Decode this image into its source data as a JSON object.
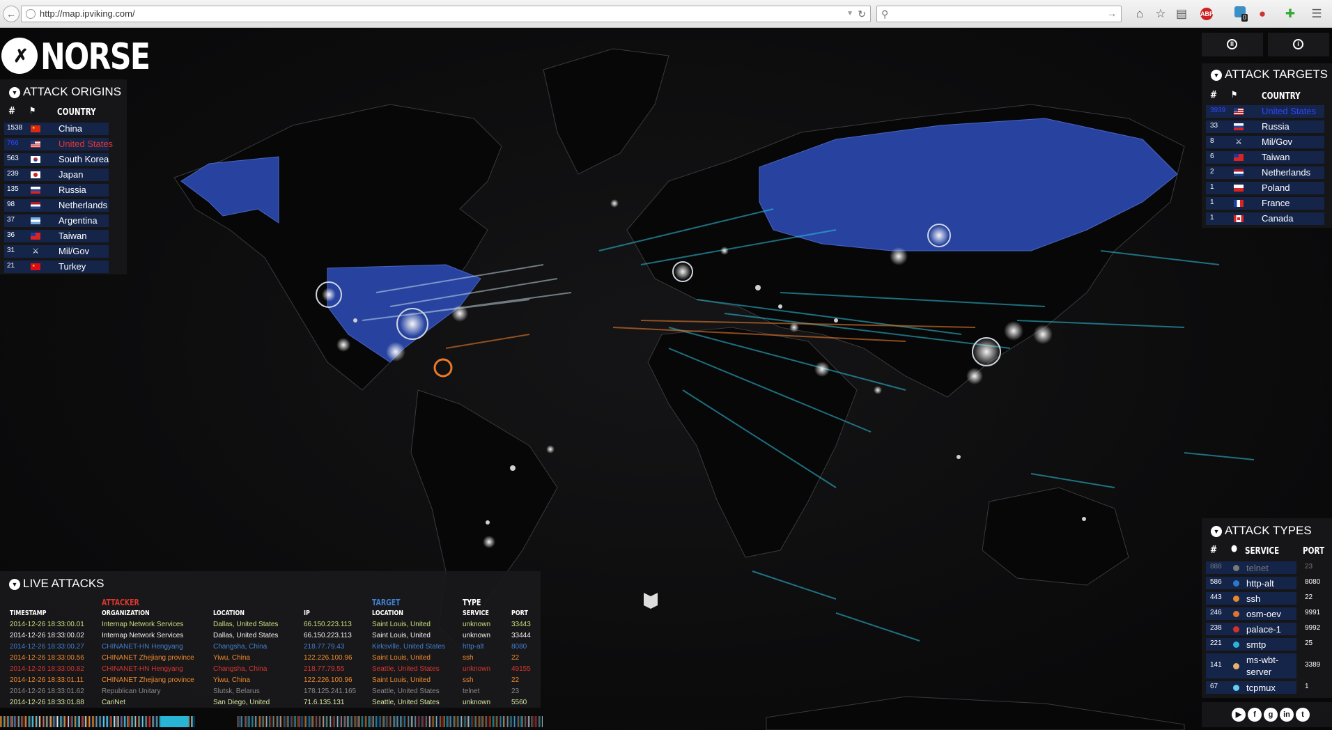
{
  "browser": {
    "url": "http://map.ipviking.com/",
    "badge_count": "0",
    "abp_label": "ABP"
  },
  "logo": {
    "wordmark": "NORSE"
  },
  "origins": {
    "title": "ATTACK ORIGINS",
    "col_country": "COUNTRY",
    "rows": [
      {
        "count": "1538",
        "country": "China",
        "highlight": false
      },
      {
        "count": "766",
        "country": "United States",
        "highlight": true
      },
      {
        "count": "563",
        "country": "South Korea",
        "highlight": false
      },
      {
        "count": "239",
        "country": "Japan",
        "highlight": false
      },
      {
        "count": "135",
        "country": "Russia",
        "highlight": false
      },
      {
        "count": "98",
        "country": "Netherlands",
        "highlight": false
      },
      {
        "count": "37",
        "country": "Argentina",
        "highlight": false
      },
      {
        "count": "36",
        "country": "Taiwan",
        "highlight": false
      },
      {
        "count": "31",
        "country": "Mil/Gov",
        "highlight": false
      },
      {
        "count": "21",
        "country": "Turkey",
        "highlight": false
      }
    ]
  },
  "targets": {
    "title": "ATTACK TARGETS",
    "col_country": "COUNTRY",
    "rows": [
      {
        "count": "3939",
        "country": "United States",
        "highlight": true
      },
      {
        "count": "33",
        "country": "Russia",
        "highlight": false
      },
      {
        "count": "8",
        "country": "Mil/Gov",
        "highlight": false
      },
      {
        "count": "6",
        "country": "Taiwan",
        "highlight": false
      },
      {
        "count": "2",
        "country": "Netherlands",
        "highlight": false
      },
      {
        "count": "1",
        "country": "Poland",
        "highlight": false
      },
      {
        "count": "1",
        "country": "France",
        "highlight": false
      },
      {
        "count": "1",
        "country": "Canada",
        "highlight": false
      }
    ]
  },
  "types": {
    "title": "ATTACK TYPES",
    "col_service": "SERVICE",
    "col_port": "PORT",
    "rows": [
      {
        "count": "888",
        "service": "telnet",
        "port": "23",
        "color": "#7a7a7a",
        "dim": true
      },
      {
        "count": "586",
        "service": "http-alt",
        "port": "8080",
        "color": "#2c78c8",
        "dim": false
      },
      {
        "count": "443",
        "service": "ssh",
        "port": "22",
        "color": "#e58a2a",
        "dim": false
      },
      {
        "count": "246",
        "service": "osm-oev",
        "port": "9991",
        "color": "#e5742a",
        "dim": false
      },
      {
        "count": "238",
        "service": "palace-1",
        "port": "9992",
        "color": "#d6302c",
        "dim": false
      },
      {
        "count": "221",
        "service": "smtp",
        "port": "25",
        "color": "#29b6d6",
        "dim": false
      },
      {
        "count": "141",
        "service": "ms-wbt-server",
        "port": "3389",
        "color": "#e8b06a",
        "dim": false
      },
      {
        "count": "67",
        "service": "tcpmux",
        "port": "1",
        "color": "#5fd0f0",
        "dim": false
      }
    ]
  },
  "live": {
    "title": "LIVE ATTACKS",
    "attacker": "ATTACKER",
    "target": "TARGET",
    "type": "TYPE",
    "h_timestamp": "TIMESTAMP",
    "h_org": "ORGANIZATION",
    "h_location": "LOCATION",
    "h_ip": "IP",
    "h_tlocation": "LOCATION",
    "h_service": "SERVICE",
    "h_port": "PORT",
    "rows": [
      {
        "ts": "2014-12-26  18:33:00.01",
        "org": "Internap Network Services",
        "loc": "Dallas, United States",
        "ip": "66.150.223.113",
        "tloc": "Saint Louis, United",
        "svc": "unknown",
        "port": "33443",
        "color": "#c6e07a"
      },
      {
        "ts": "2014-12-26  18:33:00.02",
        "org": "Internap Network Services",
        "loc": "Dallas, United States",
        "ip": "66.150.223.113",
        "tloc": "Saint Louis, United",
        "svc": "unknown",
        "port": "33444",
        "color": "#f2f2f2"
      },
      {
        "ts": "2014-12-26  18:33:00.27",
        "org": "CHINANET-HN Hengyang",
        "loc": "Changsha, China",
        "ip": "218.77.79.43",
        "tloc": "Kirksville, United States",
        "svc": "http-alt",
        "port": "8080",
        "color": "#3f7fcf"
      },
      {
        "ts": "2014-12-26  18:33:00.56",
        "org": "CHINANET Zhejiang province",
        "loc": "Yiwu, China",
        "ip": "122.226.100.96",
        "tloc": "Saint Louis, United",
        "svc": "ssh",
        "port": "22",
        "color": "#f08a2c"
      },
      {
        "ts": "2014-12-26  18:33:00.82",
        "org": "CHINANET-HN Hengyang",
        "loc": "Changsha, China",
        "ip": "218.77.79.55",
        "tloc": "Seattle, United States",
        "svc": "unknown",
        "port": "49155",
        "color": "#d8362e"
      },
      {
        "ts": "2014-12-26  18:33:01.11",
        "org": "CHINANET Zhejiang province",
        "loc": "Yiwu, China",
        "ip": "122.226.100.96",
        "tloc": "Saint Louis, United",
        "svc": "ssh",
        "port": "22",
        "color": "#f08a2c"
      },
      {
        "ts": "2014-12-26  18:33:01.62",
        "org": "Republican Unitary",
        "loc": "Slutsk, Belarus",
        "ip": "178.125.241.165",
        "tloc": "Seattle, United States",
        "svc": "telnet",
        "port": "23",
        "color": "#8a8a8a"
      },
      {
        "ts": "2014-12-26  18:33:01.88",
        "org": "CariNet",
        "loc": "San Diego, United",
        "ip": "71.6.135.131",
        "tloc": "Seattle, United States",
        "svc": "unknown",
        "port": "5560",
        "color": "#d6e8a0"
      }
    ]
  },
  "colors": {
    "land": "#060606",
    "borders": "#3a3a3e",
    "highlight_land": "#2a47a8",
    "attack_cyan": "#2fc3e0",
    "attack_orange": "#e87a2a",
    "panel_bar": "#15254a"
  }
}
